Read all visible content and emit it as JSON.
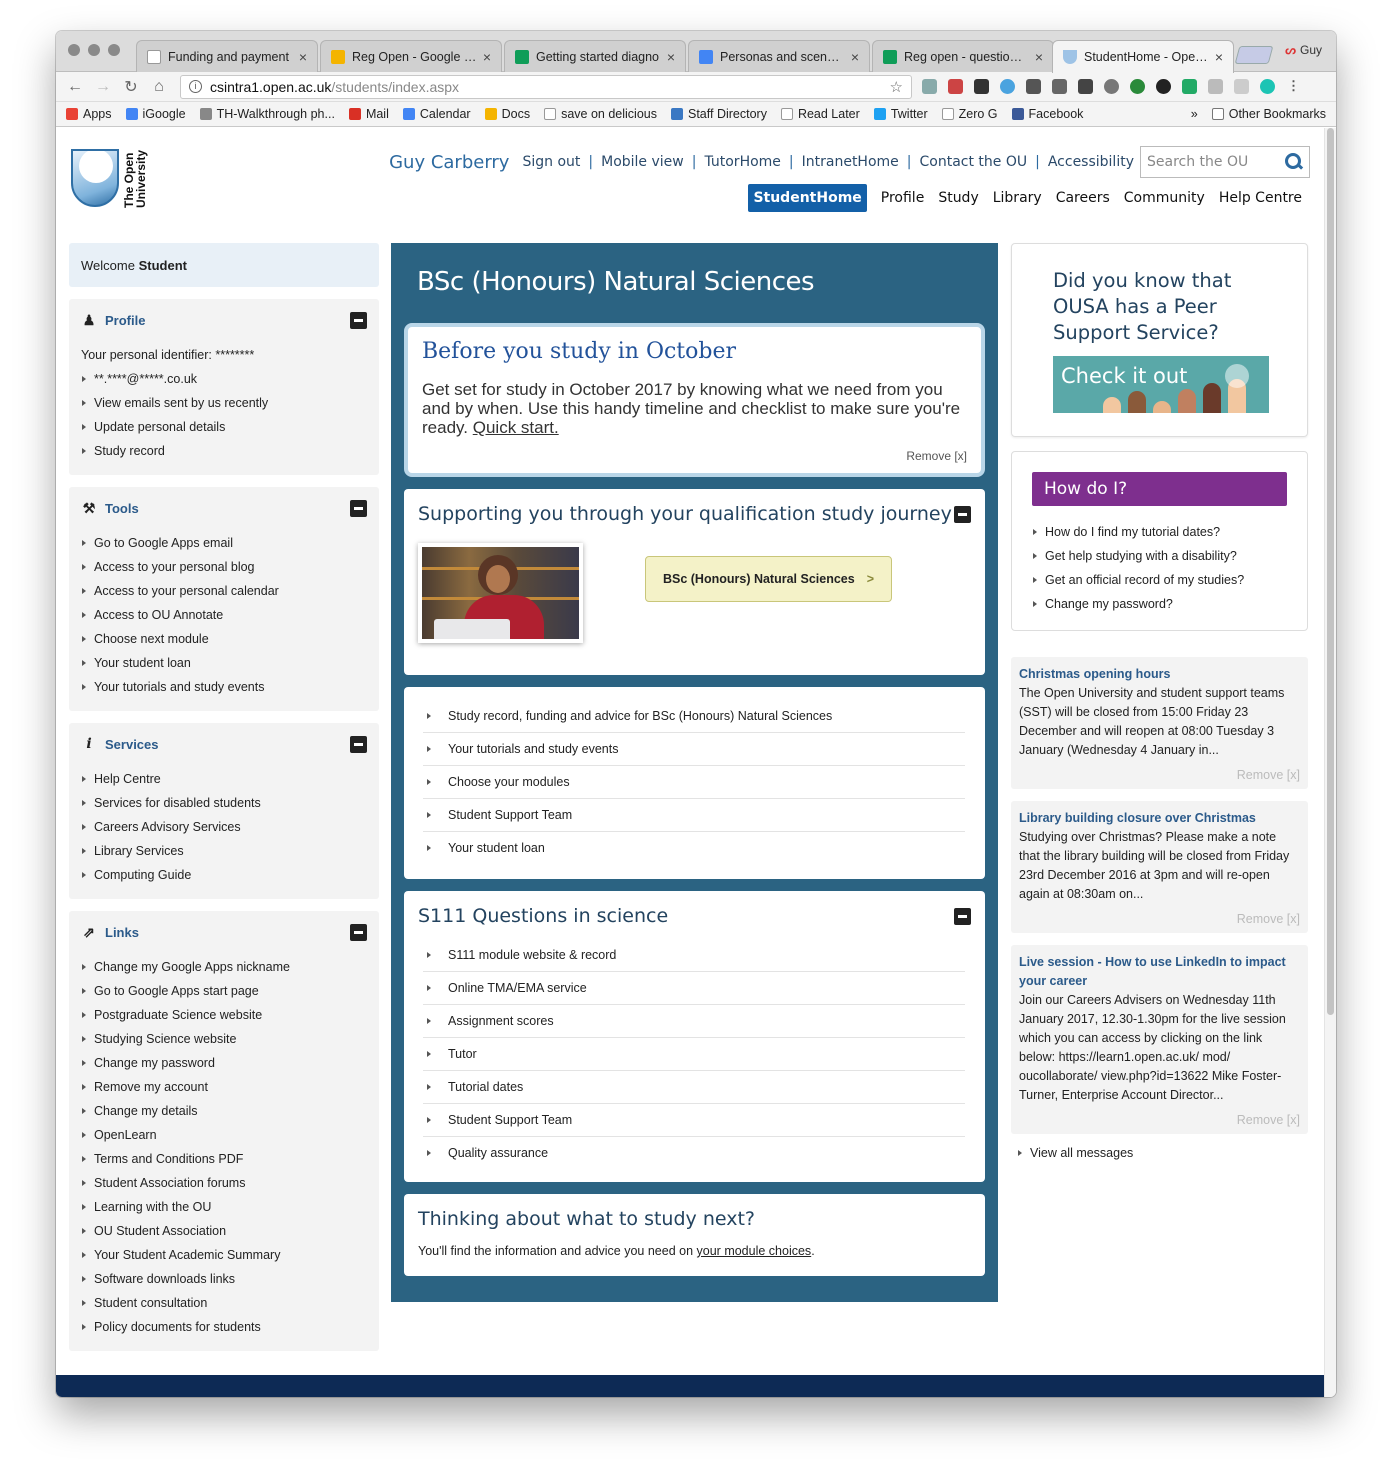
{
  "browser": {
    "tabs": [
      {
        "title": "Funding and payment",
        "color": "#ffffff"
      },
      {
        "title": "Reg Open - Google Dri",
        "color": "#f4b400"
      },
      {
        "title": "Getting started diagno",
        "color": "#0f9d58"
      },
      {
        "title": "Personas and scenario",
        "color": "#4285f4"
      },
      {
        "title": "Reg open - questions a",
        "color": "#0f9d58"
      },
      {
        "title": "StudentHome - Open U",
        "color": "#9ec3e6"
      }
    ],
    "profile_name": "Guy",
    "url_host": "csintra1.open.ac.uk",
    "url_path": "/students/index.aspx",
    "bookmarks": [
      {
        "label": "Apps",
        "color": "#e94235"
      },
      {
        "label": "iGoogle",
        "color": "#4285f4"
      },
      {
        "label": "TH-Walkthrough ph...",
        "color": "#888888"
      },
      {
        "label": "Mail",
        "color": "#d93025"
      },
      {
        "label": "Calendar",
        "color": "#4285f4"
      },
      {
        "label": "Docs",
        "color": "#f4b400"
      },
      {
        "label": "save on delicious",
        "color": "#cccccc"
      },
      {
        "label": "Staff Directory",
        "color": "#3a78c3"
      },
      {
        "label": "Read Later",
        "color": "#cccccc"
      },
      {
        "label": "Twitter",
        "color": "#1da1f2"
      },
      {
        "label": "Zero G",
        "color": "#cccccc"
      },
      {
        "label": "Facebook",
        "color": "#3b5998"
      }
    ],
    "bookmarks_more": "»",
    "other_bookmarks": "Other Bookmarks"
  },
  "header": {
    "user_name": "Guy Carberry",
    "logo_text": "The Open University",
    "utility_links": [
      "Sign out",
      "Mobile view",
      "TutorHome",
      "IntranetHome",
      "Contact the OU",
      "Accessibility"
    ],
    "search_placeholder": "Search the OU",
    "nav": [
      "StudentHome",
      "Profile",
      "Study",
      "Library",
      "Careers",
      "Community",
      "Help Centre"
    ]
  },
  "left": {
    "welcome_prefix": "Welcome",
    "welcome_name": "Student",
    "profile": {
      "title": "Profile",
      "identifier": "Your personal identifier: ********",
      "items": [
        "**.****@*****.co.uk",
        "View emails sent by us recently",
        "Update personal details",
        "Study record"
      ]
    },
    "tools": {
      "title": "Tools",
      "items": [
        "Go to Google Apps email",
        "Access to your personal blog",
        "Access to your personal calendar",
        "Access to OU Annotate",
        "Choose next module",
        "Your student loan",
        "Your tutorials and study events"
      ]
    },
    "services": {
      "title": "Services",
      "items": [
        "Help Centre",
        "Services for disabled students",
        "Careers Advisory Services",
        "Library Services",
        "Computing Guide"
      ]
    },
    "links": {
      "title": "Links",
      "items": [
        "Change my Google Apps nickname",
        "Go to Google Apps start page",
        "Postgraduate Science website",
        "Studying Science website",
        "Change my password",
        "Remove my account",
        "Change my details",
        "OpenLearn",
        "Terms and Conditions PDF",
        "Student Association forums",
        "Learning with the OU",
        "OU Student Association",
        "Your Student Academic Summary",
        "Software downloads links",
        "Student consultation",
        "Policy documents for students"
      ]
    }
  },
  "centre": {
    "title": "BSc (Honours) Natural Sciences",
    "notice": {
      "heading": "Before you study in October",
      "body": "Get set for study in October 2017 by knowing what we need from you and by when. Use this handy timeline and checklist to make sure you're ready.",
      "link": "Quick start.",
      "remove": "Remove [x]"
    },
    "journey": {
      "heading": "Supporting you through your qualification study journey",
      "button": "BSc (Honours) Natural Sciences",
      "chevron": ">"
    },
    "qual_links": [
      "Study record, funding and advice for BSc (Honours) Natural Sciences",
      "Your tutorials and study events",
      "Choose your modules",
      "Student Support Team",
      "Your student loan"
    ],
    "module": {
      "heading": "S111 Questions in science",
      "items": [
        "S111 module website & record",
        "Online TMA/EMA service",
        "Assignment scores",
        "Tutor",
        "Tutorial dates",
        "Student Support Team",
        "Quality assurance"
      ]
    },
    "next": {
      "heading": "Thinking about what to study next?",
      "text": "You'll find the information and advice you need on",
      "link": "your module choices",
      "end": "."
    }
  },
  "right": {
    "promo": {
      "heading": "Did you know that OUSA has a Peer Support Service?",
      "button": "Check it out"
    },
    "howdo": {
      "title": "How do I?",
      "items": [
        "How do I find my tutorial dates?",
        "Get help studying with a disability?",
        "Get an official record of my studies?",
        "Change my password?"
      ]
    },
    "messages": [
      {
        "title": "Christmas opening hours",
        "body": "The Open University and student support teams (SST) will be closed from 15:00 Friday 23 December and will reopen at 08:00 Tuesday 3 January (Wednesday 4 January in...",
        "remove": "Remove [x]"
      },
      {
        "title": "Library building closure over Christmas",
        "body": "Studying over Christmas? Please make a note that the library building will be closed from Friday 23rd December 2016 at 3pm and will re-open again at 08:30am on...",
        "remove": "Remove [x]"
      },
      {
        "title": "Live session - How to use LinkedIn to impact your career",
        "body": "Join our Careers Advisers on Wednesday 11th January 2017, 12.30-1.30pm for the live session which you can access by clicking on the link below: https://learn1.open.ac.uk/ mod/ oucollaborate/ view.php?id=13622 Mike Foster-Turner, Enterprise Account Director...",
        "remove": "Remove [x]"
      }
    ],
    "view_all": "View all messages"
  }
}
